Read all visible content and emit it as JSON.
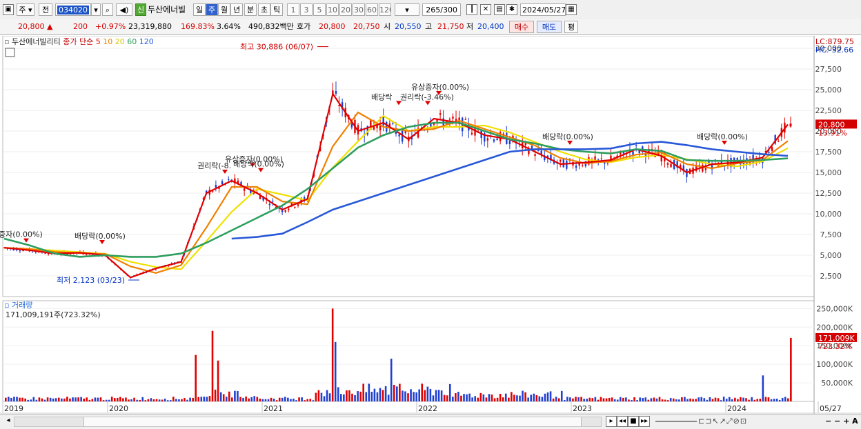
{
  "toolbar": {
    "market": "주",
    "prev_label": "전",
    "code": "034020",
    "new_badge": "신",
    "stock_name": "두산에너빌",
    "period_tabs": [
      "일",
      "주",
      "월",
      "년",
      "분",
      "초",
      "틱"
    ],
    "active_period": "주",
    "intervals": [
      "1",
      "3",
      "5",
      "10",
      "20",
      "30",
      "60",
      "120"
    ],
    "count": "265",
    "count_total": "/300",
    "date": "2024/05/27"
  },
  "quote": {
    "price": "20,800",
    "change": "200",
    "change_pct": "+0.97%",
    "volume": "23,319,880",
    "volume_ratio": "169.83%",
    "turnover": "3.64%",
    "amount": "490,832백만",
    "hoga_label": "호가",
    "ask": "20,800",
    "bid": "20,750",
    "open_label": "시",
    "open": "20,550",
    "high_label": "고",
    "high": "21,750",
    "low_label": "저",
    "low": "20,400",
    "buy_label": "매수",
    "sell_label": "매도",
    "eval_label": "평"
  },
  "price_panel": {
    "stock_label": "두산에너빌리티",
    "ma_prefix": "종가 단순",
    "ma_periods": [
      "5",
      "10",
      "20",
      "60",
      "120"
    ],
    "lc_label": "LC:879.75",
    "hc_label": "HC:-32.66",
    "current_tag": "20,800",
    "current_pct": "13.91%",
    "high_note": "최고 30,886 (06/07)",
    "low_note": "최저 2,123 (03/23)",
    "events": [
      "증자(0.00%)",
      "배당락(0.00%)",
      "권리락(-8.",
      "유상증자(0.00%)",
      "배당락(0.00%)",
      "유상증자(0.00%)",
      "배당락",
      "권리락(-3.46%)",
      "배당락(0.00%)",
      "배당락(0.00%)"
    ]
  },
  "volume_panel": {
    "title": "거래량",
    "summary": "171,009,191주(723.32%)",
    "current_tag": "171,009K",
    "current_pct": "723.32%"
  },
  "x_axis_labels": [
    "2019",
    "2020",
    "2021",
    "2022",
    "2023",
    "2024",
    "05/27"
  ],
  "chart_data": [
    {
      "type": "candlestick",
      "title": "두산에너빌리티",
      "yticks": [
        "2,500",
        "5,000",
        "7,500",
        "10,000",
        "12,500",
        "15,000",
        "17,500",
        "20,000",
        "22,500",
        "25,000",
        "27,500",
        "30,000"
      ],
      "ylim": [
        0,
        31500
      ],
      "x": [
        "2019-01",
        "2019-04",
        "2019-07",
        "2019-10",
        "2020-01",
        "2020-03",
        "2020-05",
        "2020-07",
        "2020-09",
        "2020-11",
        "2021-01",
        "2021-03",
        "2021-05",
        "2021-06",
        "2021-08",
        "2021-10",
        "2021-12",
        "2022-02",
        "2022-04",
        "2022-06",
        "2022-08",
        "2022-10",
        "2022-12",
        "2023-02",
        "2023-04",
        "2023-06",
        "2023-08",
        "2023-10",
        "2023-12",
        "2024-02",
        "2024-04",
        "2024-05"
      ],
      "close": [
        5900,
        5600,
        5200,
        5300,
        5000,
        2300,
        3400,
        4200,
        12500,
        14000,
        12500,
        10500,
        11800,
        24500,
        20000,
        21000,
        19000,
        21500,
        21000,
        19500,
        19000,
        17500,
        16000,
        16200,
        16500,
        17800,
        17000,
        15000,
        16000,
        16200,
        16800,
        20800
      ],
      "series": [
        {
          "name": "5",
          "color": "#e00000"
        },
        {
          "name": "10",
          "color": "#f08000"
        },
        {
          "name": "20",
          "color": "#f0e000"
        },
        {
          "name": "60",
          "color": "#2e9e5e"
        },
        {
          "name": "120",
          "color": "#2858d8"
        }
      ],
      "ma60": [
        7000,
        6200,
        5200,
        4800,
        5000,
        4800,
        4800,
        5200,
        6500,
        8000,
        9500,
        11000,
        13000,
        15500,
        18000,
        19500,
        20500,
        21000,
        21000,
        20000,
        19000,
        18500,
        17800,
        17500,
        17300,
        17800,
        17600,
        16500,
        16400,
        16400,
        16500,
        16700
      ],
      "ma120": [
        null,
        null,
        null,
        null,
        null,
        null,
        null,
        null,
        null,
        7000,
        7200,
        7600,
        9000,
        10500,
        11500,
        12500,
        13500,
        14500,
        15500,
        16500,
        17500,
        17800,
        17800,
        17800,
        17900,
        18500,
        18700,
        18300,
        17800,
        17500,
        17200,
        17000
      ]
    },
    {
      "type": "bar",
      "title": "거래량",
      "yticks": [
        "50,000K",
        "100,000K",
        "150,000K",
        "200,000K",
        "250,000K"
      ],
      "ylim": [
        0,
        260000
      ],
      "events": [
        {
          "label": "2020-06",
          "value": 125000
        },
        {
          "label": "2020-08",
          "value": 190000
        },
        {
          "label": "2020-09",
          "value": 110000
        },
        {
          "label": "2021-06",
          "value": 250000
        },
        {
          "label": "2021-07",
          "value": 160000
        },
        {
          "label": "2021-10",
          "value": 115000
        },
        {
          "label": "2024-04",
          "value": 70000
        },
        {
          "label": "2024-05",
          "value": 171009
        }
      ]
    }
  ]
}
